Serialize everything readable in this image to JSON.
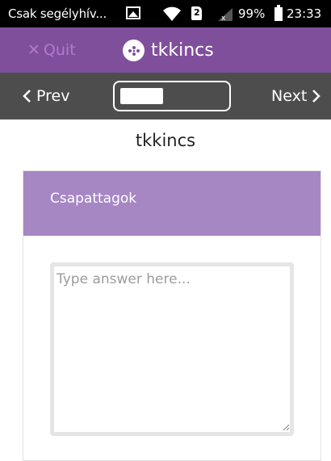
{
  "status_bar": {
    "notification": "Csak segélyhív...",
    "sim_label": "2",
    "battery": "99%",
    "time": "23:33"
  },
  "app_bar": {
    "quit_label": "Quit",
    "app_name": "tkkincs"
  },
  "nav": {
    "prev_label": "Prev",
    "next_label": "Next"
  },
  "page": {
    "title": "tkkincs"
  },
  "card": {
    "header": "Csapattagok",
    "answer_placeholder": "Type answer here...",
    "answer_value": ""
  },
  "colors": {
    "app_bar": "#804f9c",
    "card_header": "#a786c4",
    "nav_bar": "#4d4d4d"
  }
}
